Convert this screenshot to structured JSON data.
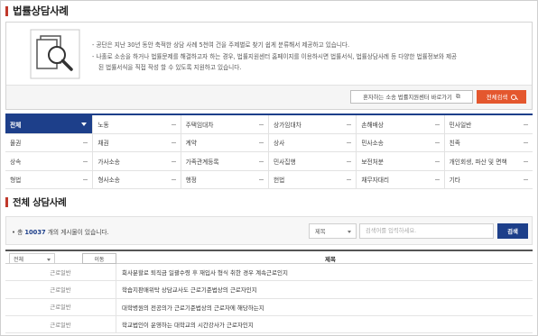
{
  "header": {
    "title": "법률상담사례"
  },
  "intro": {
    "icon": "document-search-icon",
    "lines": [
      "- 공단은 지난 30년 동안 축적한 상담 사례 5천여 건을 주제별로 찾기 쉽게 분류해서 제공하고 있습니다.",
      "- 나홀로 소송을 하거나 법률문제를 해결하고자 하는 경우, 법률지원센터 홈페이지를 이용하시면 법률서식, 법률상담사례 등 다양한 법률정보와 제공",
      "된 법률서식을 직접 작성 할 수 있도록 지원하고 있습니다."
    ],
    "link_button": "혼자하는 소송 법률지원센터 바로가기",
    "all_search_button": "전체검색",
    "accent_color": "#e4572e"
  },
  "categories": [
    "전체",
    "노동",
    "주택임대차",
    "상가임대차",
    "손해배상",
    "민사일반",
    "물권",
    "채권",
    "계약",
    "상사",
    "민사소송",
    "친족",
    "상속",
    "가사소송",
    "가족관계등록",
    "민사집행",
    "보전처분",
    "개인회생, 파산 및 면책",
    "형법",
    "형사소송",
    "행정",
    "헌법",
    "채무자대리",
    "기타"
  ],
  "active_category": "전체",
  "section": {
    "title": "전체 상담사례"
  },
  "search": {
    "count_prefix": "• 총 ",
    "count": "10037",
    "count_suffix": " 개의 게시물이 있습니다.",
    "field_select": "제목",
    "placeholder": "검색어를 입력하세요.",
    "search_button": "검색",
    "brand_color": "#1d3f8a"
  },
  "list": {
    "filter_select": "전체",
    "move_button": "이동",
    "title_header": "제목",
    "rows": [
      {
        "category": "근로일반",
        "title": "회사분할로 퇴직금 일괄수령 후 재입사 형식 취한 경우 계속근로인지"
      },
      {
        "category": "근로일반",
        "title": "학습지판매위탁 상담교사도 근로기준법상의 근로자인지"
      },
      {
        "category": "근로일반",
        "title": "대학병원의 전공의가 근로기준법상의 근로자에 해당하는지"
      },
      {
        "category": "근로일반",
        "title": "학교법인이 운영하는 대학교의 시간강사가 근로자인지"
      }
    ]
  }
}
